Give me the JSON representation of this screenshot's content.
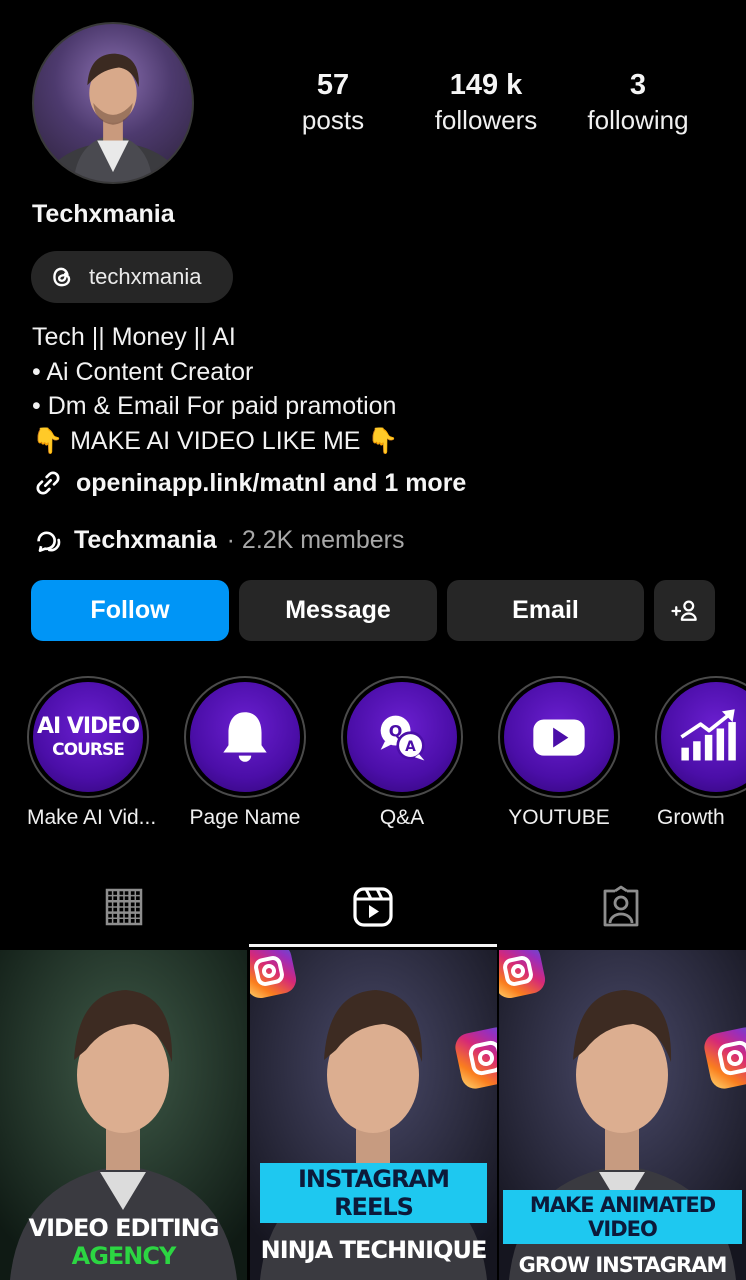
{
  "profile": {
    "username": "Techxmania",
    "threads_handle": "techxmania",
    "stats": [
      {
        "value": "57",
        "label": "posts"
      },
      {
        "value": "149 k",
        "label": "followers"
      },
      {
        "value": "3",
        "label": "following"
      }
    ],
    "bio_lines": [
      "Tech || Money || AI",
      "• Ai Content Creator",
      "• Dm & Email For paid pramotion",
      "👇 MAKE AI VIDEO LIKE ME 👇"
    ],
    "link_text": "openinapp.link/matnl and 1 more",
    "channel_name": "Techxmania",
    "channel_members": "· 2.2K members"
  },
  "actions": {
    "follow": "Follow",
    "message": "Message",
    "email": "Email",
    "add_user_icon": "add-person-icon"
  },
  "highlights": [
    {
      "caption": "Make AI Vid...",
      "cover_line1": "AI VIDEO",
      "cover_line2": "COURSE"
    },
    {
      "caption": "Page Name",
      "icon": "bell-icon"
    },
    {
      "caption": "Q&A",
      "icon": "qa-bubbles-icon",
      "q": "Q",
      "a": "A"
    },
    {
      "caption": "YOUTUBE",
      "icon": "youtube-play-icon"
    },
    {
      "caption": "Growth",
      "icon": "growth-chart-icon"
    }
  ],
  "tabs": [
    {
      "name": "posts",
      "icon": "grid-icon"
    },
    {
      "name": "reels",
      "icon": "reels-icon",
      "active": true
    },
    {
      "name": "tagged",
      "icon": "tagged-person-icon"
    }
  ],
  "posts": [
    {
      "line1": "VIDEO EDITING",
      "line2": "AGENCY"
    },
    {
      "line1": "INSTAGRAM REELS",
      "line2": "NINJA TECHNIQUE"
    },
    {
      "line1": "MAKE ANIMATED VIDEO",
      "line2": "GROW INSTAGRAM"
    }
  ],
  "colors": {
    "background": "#000000",
    "follow_button": "#0095f6",
    "secondary_button": "#262626",
    "highlight_purple": "#4b0ea8",
    "caption_cyan": "#1ec8f0",
    "caption_green": "#2cd642"
  }
}
